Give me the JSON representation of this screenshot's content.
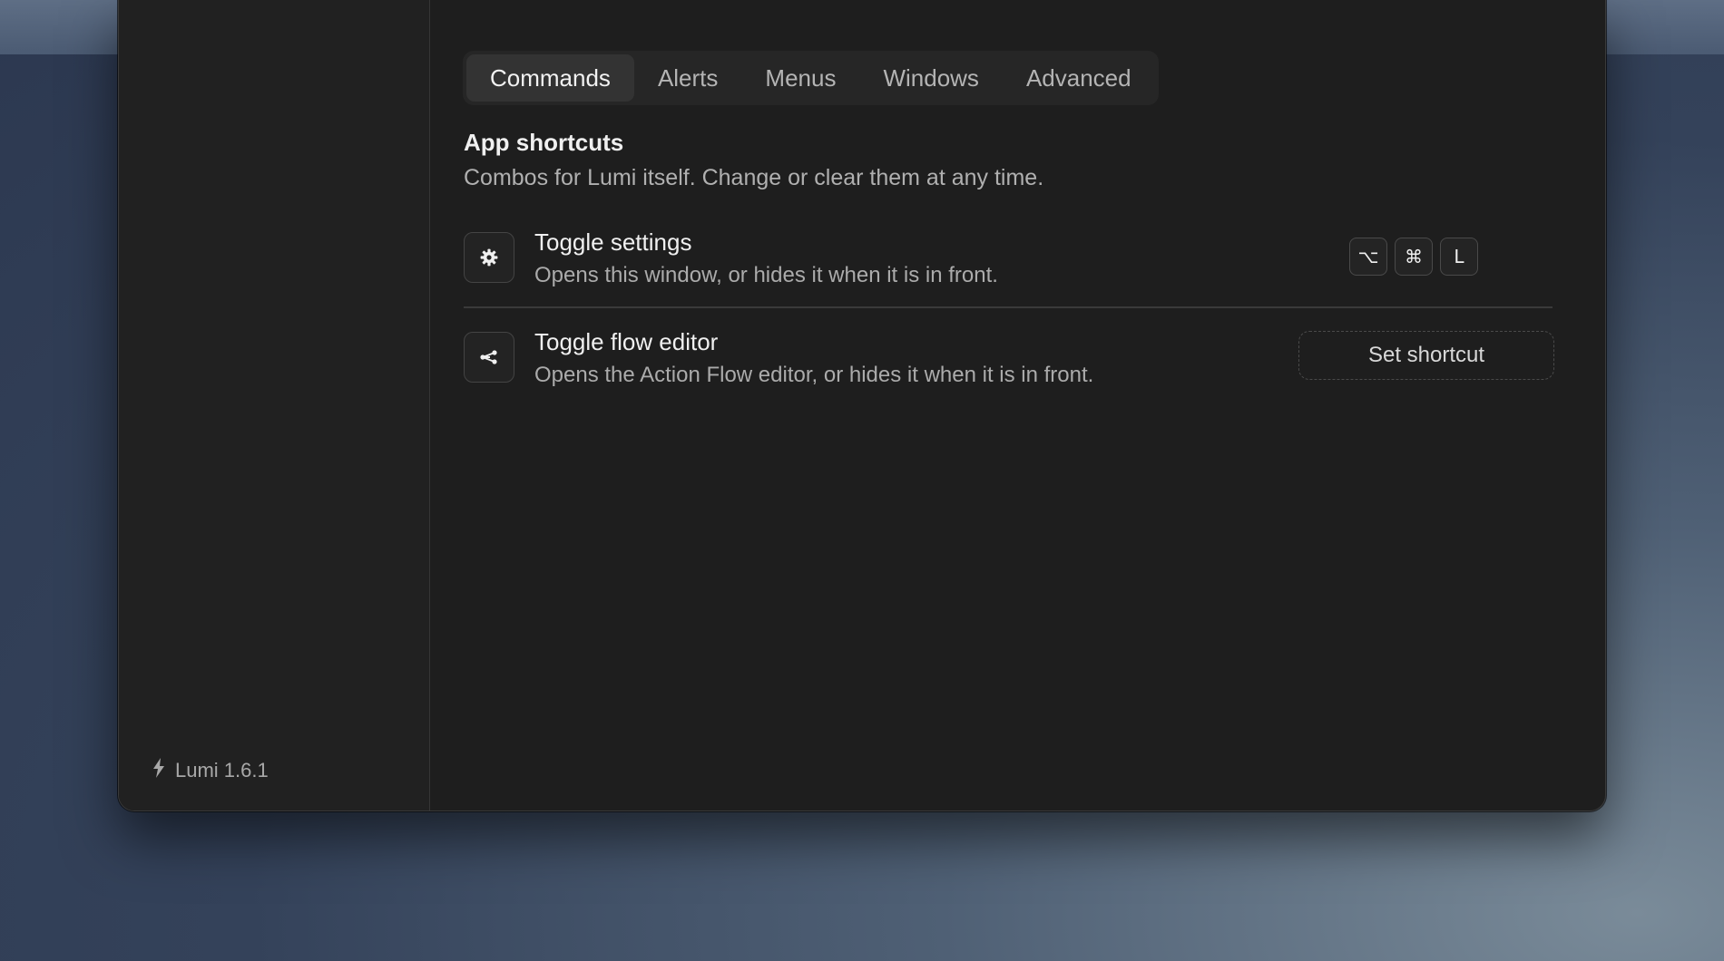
{
  "tabs": [
    {
      "label": "Commands",
      "active": true
    },
    {
      "label": "Alerts",
      "active": false
    },
    {
      "label": "Menus",
      "active": false
    },
    {
      "label": "Windows",
      "active": false
    },
    {
      "label": "Advanced",
      "active": false
    }
  ],
  "section": {
    "title": "App shortcuts",
    "description": "Combos for Lumi itself. Change or clear them at any time."
  },
  "shortcuts": [
    {
      "icon": "gear-icon",
      "title": "Toggle settings",
      "description": "Opens this window, or hides it when it is in front.",
      "keys": [
        "⌥",
        "⌘",
        "L"
      ]
    },
    {
      "icon": "share-nodes-icon",
      "title": "Toggle flow editor",
      "description": "Opens the Action Flow editor, or hides it when it is in front.",
      "set_label": "Set shortcut"
    }
  ],
  "sidebar": {
    "version_icon": "lightning-icon",
    "version": "Lumi 1.6.1"
  },
  "colors": {
    "window_bg": "#1e1e1e",
    "sidebar_bg": "#212121",
    "tab_active_bg": "#333333",
    "text_primary": "#f0f0f0",
    "text_secondary": "#ababab"
  }
}
